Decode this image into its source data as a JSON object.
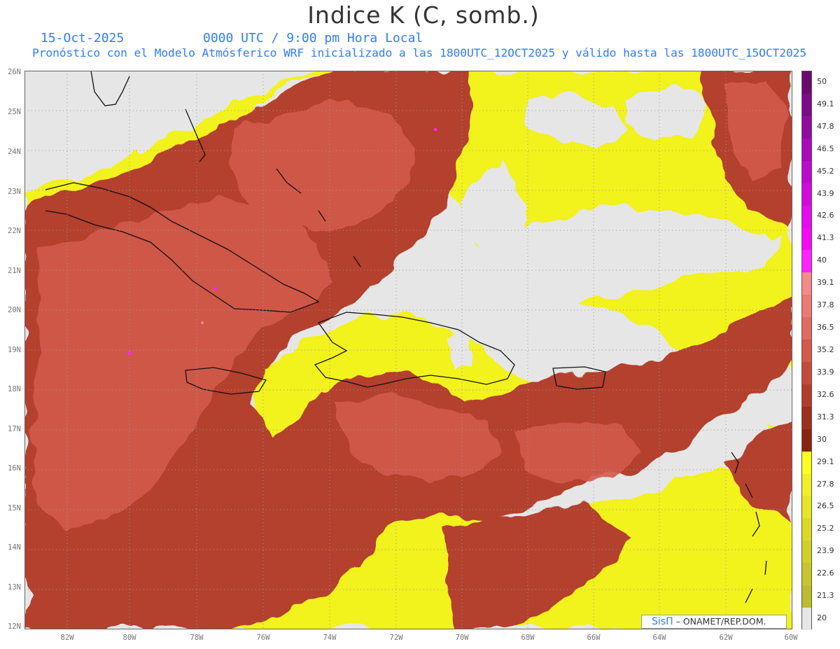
{
  "header": {
    "title": "Indice K (C, somb.)",
    "date": "15-Oct-2025",
    "time": "0000 UTC / 9:00 pm Hora Local",
    "description": "Pronóstico con el Modelo Atmósferico WRF inicializado a las 1800UTC_12OCT2025 y válido hasta las  1800UTC_15OCT2025"
  },
  "map": {
    "lat_range": [
      12,
      26
    ],
    "lon_range": [
      -83,
      -60
    ],
    "lat_labels": [
      "26N",
      "25N",
      "24N",
      "23N",
      "22N",
      "21N",
      "20N",
      "19N",
      "18N",
      "17N",
      "16N",
      "15N",
      "14N",
      "13N",
      "12N"
    ],
    "lon_labels": [
      "82W",
      "80W",
      "78W",
      "76W",
      "74W",
      "72W",
      "70W",
      "68W",
      "66W",
      "64W",
      "62W",
      "60W"
    ]
  },
  "colorbar": {
    "labels": [
      "50",
      "49.1",
      "47.8",
      "46.5",
      "45.2",
      "43.9",
      "42.6",
      "41.3",
      "40",
      "39.1",
      "37.8",
      "36.5",
      "35.2",
      "33.9",
      "32.6",
      "31.3",
      "30",
      "29.1",
      "27.8",
      "26.5",
      "25.2",
      "23.9",
      "22.6",
      "21.3",
      "20"
    ],
    "colors": [
      "#6a0a6e",
      "#7d0a88",
      "#920aa0",
      "#a80ab8",
      "#be0acf",
      "#d20ae0",
      "#e60af0",
      "#f50af5",
      "#ff22ff",
      "#f48a8a",
      "#ec7a72",
      "#e26a60",
      "#d4594c",
      "#c44a3c",
      "#b23c2e",
      "#9e2f20",
      "#8a2412",
      "#ffff20",
      "#f0f024",
      "#e6e626",
      "#dada26",
      "#d0d02a",
      "#c6c62c",
      "#bcbc2e",
      "#e6e6e6"
    ]
  },
  "credit": {
    "brand": "SisΠ",
    "text": " – ONAMET/REP.DOM."
  }
}
